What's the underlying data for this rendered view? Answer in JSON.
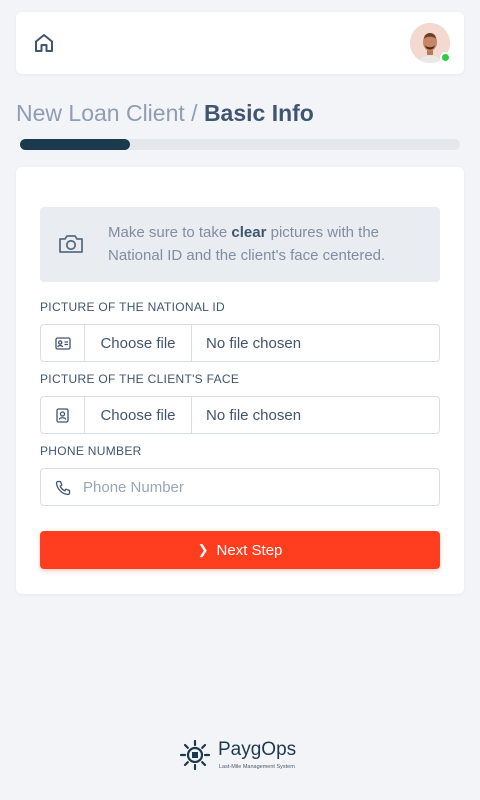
{
  "header": {
    "home_icon": "home-icon",
    "avatar_status_color": "#2ecc40"
  },
  "page": {
    "title_prefix": "New Loan Client / ",
    "title_current": "Basic Info",
    "progress_fraction": 0.25
  },
  "notice": {
    "icon": "camera-icon",
    "text_before": "Make sure to take ",
    "text_bold": "clear",
    "text_after": " pictures with the National ID and the client's face centered."
  },
  "form": {
    "national_id": {
      "label": "PICTURE OF THE NATIONAL ID",
      "icon": "id-card-icon",
      "button": "Choose file",
      "status": "No file chosen"
    },
    "client_face": {
      "label": "PICTURE OF THE CLIENT'S FACE",
      "icon": "portrait-icon",
      "button": "Choose file",
      "status": "No file chosen"
    },
    "phone": {
      "label": "PHONE NUMBER",
      "icon": "phone-icon",
      "placeholder": "Phone Number",
      "value": ""
    },
    "next_button": "Next Step"
  },
  "colors": {
    "accent": "#ff3d1f",
    "progress": "#1c3a4d"
  },
  "footer": {
    "brand": "PaygOps",
    "tagline": "Last-Mile Management System"
  }
}
